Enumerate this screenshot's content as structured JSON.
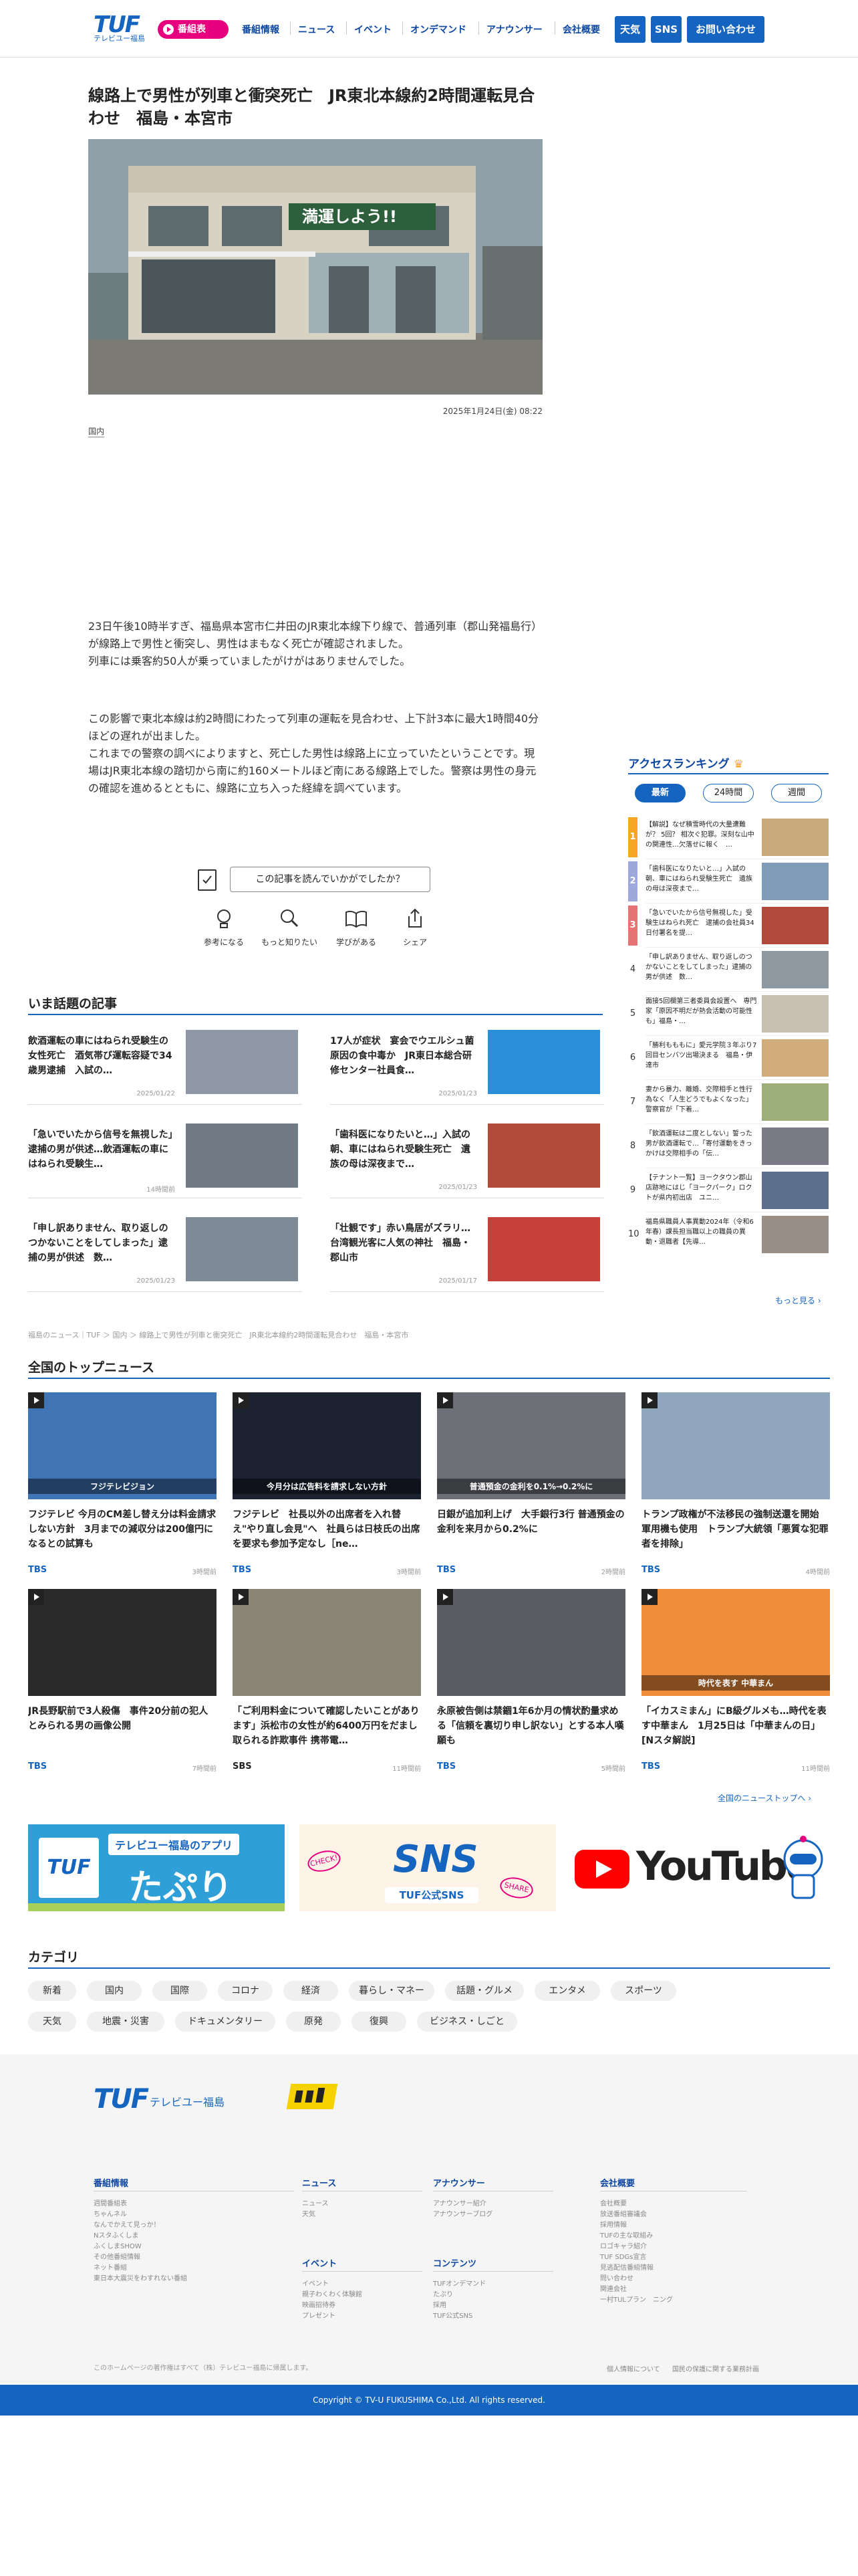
{
  "header": {
    "logo_text": "TUF",
    "logo_sub": "テレビユー福島",
    "program_button": "番組表",
    "nav": [
      "番組情報",
      "ニュース",
      "イベント",
      "オンデマンド",
      "アナウンサー",
      "会社概要"
    ],
    "weather": "天気",
    "sns": "SNS",
    "contact": "お問い合わせ"
  },
  "article": {
    "title": "線路上で男性が列車と衝突死亡　JR東北本線約2時間運転見合わせ　福島・本宮市",
    "photo_sign": "満運しよう!!",
    "date": "2025年1月24日(金) 08:22",
    "tag": "国内",
    "para1": [
      "23日午後10時半すぎ、福島県本宮市仁井田のJR東北本線下り線で、普通列車（郡山発福島行）が線路上で男性と衝突し、男性はまもなく死亡が確認されました。",
      "列車には乗客約50人が乗っていましたがけがはありませんでした。"
    ],
    "para2": [
      "この影響で東北本線は約2時間にわたって列車の運転を見合わせ、上下計3本に最大1時間40分ほどの遅れが出ました。",
      "これまでの警察の調べによりますと、死亡した男性は線路上に立っていたということです。現場はJR東北本線の踏切から南に約160メートルほど南にある線路上でした。警察は男性の身元の確認を進めるとともに、線路に立ち入った経緯を調べています。"
    ],
    "feedback_question": "この記事を読んでいかがでしたか？",
    "reactions": [
      "参考になる",
      "もっと知りたい",
      "学びがある",
      "シェア"
    ]
  },
  "ranking": {
    "heading": "アクセスランキング",
    "tabs": [
      "最新",
      "24時間",
      "週間"
    ],
    "items": [
      {
        "n": "1",
        "title": "【解説】なぜ積雪時代の大量遭難が？ 5回？ 相次ぐ犯罪。深刻な山中の関連性…欠落せに報く　…",
        "color": "#f5a623"
      },
      {
        "n": "2",
        "title": "「歯科医になりたいと…」入試の朝、車にはねられ受験生死亡　遺族の母は深夜まで…",
        "color": "#9fa8da"
      },
      {
        "n": "3",
        "title": "「急いでいたから信号無視した」受験生はねられ死亡　逮捕の会社員34日付署名を提…",
        "color": "#e57373"
      },
      {
        "n": "4",
        "title": "「申し訳ありません、取り返しのつかないことをしてしまった」逮捕の男が供述　数…",
        "color": ""
      },
      {
        "n": "5",
        "title": "面接5回欄第三者委員会設置へ　専門家「原因不明だが熱会活動の可能性も」福島・…",
        "color": ""
      },
      {
        "n": "6",
        "title": "「勝利もももに」愛元学院３年ぶり7回目センバツ出場決まる　福島・伊達市",
        "color": ""
      },
      {
        "n": "7",
        "title": "妻から暴力、離婚、交際相手と性行為なく「人生どうでもよくなった」警察官が「下着…",
        "color": ""
      },
      {
        "n": "8",
        "title": "「飲酒運転は二度としない」誓った男が飲酒運転で…「寄付運動をきっかけは交際相手の「伝…",
        "color": ""
      },
      {
        "n": "9",
        "title": "【テナント一覧】ヨークタウン郡山店跡地にはじ「ヨークパーク」ロクトが県内初出店　ユニ…",
        "color": ""
      },
      {
        "n": "10",
        "title": "福島県職員人事異動2024年（令和6年春）課長担当職以上の職員の異動・退職者【先導…",
        "color": ""
      }
    ],
    "more": "もっと見る"
  },
  "trending": {
    "heading": "いま話題の記事",
    "items": [
      {
        "title": "飲酒運転の車にはねられ受験生の女性死亡　酒気帯び運転容疑で34歳男逮捕　入試の…",
        "date": "2025/01/22"
      },
      {
        "title": "17人が症状　宴会でウエルシュ菌原因の食中毒か　JR東日本総合研修センター社員食…",
        "date": "2025/01/23"
      },
      {
        "title": "「急いでいたから信号を無視した」逮捕の男が供述…飲酒運転の車にはねられ受験生…",
        "date": "14時間前"
      },
      {
        "title": "「歯科医になりたいと…」入試の朝、車にはねられ受験生死亡　遺族の母は深夜まで…",
        "date": "2025/01/23"
      },
      {
        "title": "「申し訳ありません、取り返しのつかないことをしてしまった」逮捕の男が供述　数…",
        "date": "2025/01/23"
      },
      {
        "title": "「壮観です」赤い鳥居がズラリ…台湾観光客に人気の神社　福島・郡山市",
        "date": "2025/01/17"
      }
    ]
  },
  "breadcrumb": "福島のニュース｜TUF ＞ 国内 ＞ 線路上で男性が列車と衝突死亡　JR東北本線約2時間運転見合わせ　福島・本宮市",
  "topnews": {
    "heading": "全国のトップニュース",
    "items": [
      {
        "title": "フジテレビ 今月のCM差し替え分は料金請求しない方針　3月までの減収分は200億円になるとの試算も",
        "src": "TBS",
        "date": "3時間前"
      },
      {
        "title": "フジテレビ　社長以外の出席者を入れ替え\"やり直し会見\"へ　社員らは日枝氏の出席を要求も参加予定なし［ne…",
        "src": "TBS",
        "date": "3時間前"
      },
      {
        "title": "日銀が追加利上げ　大手銀行3行 普通預金の金利を来月から0.2%に",
        "src": "TBS",
        "date": "2時間前"
      },
      {
        "title": "トランプ政権が不法移民の強制送還を開始　軍用機も使用　トランプ大統領「悪質な犯罪者を排除」",
        "src": "TBS",
        "date": "4時間前"
      },
      {
        "title": "JR長野駅前で3人殺傷　事件20分前の犯人とみられる男の画像公開",
        "src": "TBS",
        "date": "7時間前"
      },
      {
        "title": "「ご利用料金について確認したいことがあります」浜松市の女性が約6400万円をだまし取られる詐欺事件 携帯電…",
        "src": "SBS",
        "date": "11時間前"
      },
      {
        "title": "永原被告側は禁錮1年6か月の情状酌量求める「信頼を裏切り申し訳ない」とする本人嘆願も",
        "src": "TBS",
        "date": "5時間前"
      },
      {
        "title": "「イカスミまん」にB級グルメも…時代を表す中華まん　1月25日は「中華まんの日」[Nスタ解説]",
        "src": "TBS",
        "date": "11時間前"
      }
    ],
    "img_labels": [
      "フジテレビジョン",
      "今月分は広告料を請求しない方針",
      "普通預金の金利を0.1%→0.2%に",
      "",
      "",
      "",
      "",
      "時代を表す 中華まん"
    ],
    "more": "全国のニューストップへ"
  },
  "banners": {
    "app_top": "テレビユー福島のアプリ",
    "app_name": "たぷり",
    "sns_title": "SNS",
    "sns_sub": "TUF公式SNS",
    "youtube": "YouTube"
  },
  "category": {
    "heading": "カテゴリ",
    "row1": [
      "新着",
      "国内",
      "国際",
      "コロナ",
      "経済",
      "暮らし・マネー",
      "話題・グルメ",
      "エンタメ",
      "スポーツ"
    ],
    "row2": [
      "天気",
      "地震・災害",
      "ドキュメンタリー",
      "原発",
      "復興",
      "ビジネス・しごと"
    ]
  },
  "footer": {
    "logo": "TUF",
    "logo_sub": "テレビユー福島",
    "cols": [
      {
        "h": "番組情報",
        "items": [
          "週間番組表",
          "ちゃんネル",
          "なんでかえて見っか！",
          "Nスタふくしま",
          "ふくしまSHOW",
          "その他番組情報",
          "ネット番組",
          "東日本大震災をわすれない番組"
        ]
      },
      {
        "h": "ニュース",
        "items": [
          "ニュース",
          "天気"
        ]
      },
      {
        "h": "イベント",
        "items": [
          "イベント",
          "親子わくわく体験館",
          "映画招待券",
          "プレゼント"
        ]
      },
      {
        "h": "アナウンサー",
        "items": [
          "アナウンサー紹介",
          "アナウンサーブログ"
        ]
      },
      {
        "h": "コンテンツ",
        "items": [
          "TUFオンデマンド",
          "たぷり",
          "採用",
          "TUF公式SNS"
        ]
      },
      {
        "h": "会社概要",
        "items": [
          "会社概要",
          "放送番組審議会",
          "採用情報",
          "TUFの主な取組み",
          "ロゴキャラ紹介",
          "TUF SDGs宣言",
          "見逃配信番組情報",
          "問い合わせ",
          "関連会社",
          "一村TULプラン　ニング"
        ]
      }
    ],
    "note": "このホームページの著作権はすべて（株）テレビユー福島に帰属します。",
    "policy1": "個人情報について",
    "policy2": "国民の保護に関する業務計画",
    "copyright": "Copyright © TV-U FUKUSHIMA Co.,Ltd. All rights reserved."
  }
}
